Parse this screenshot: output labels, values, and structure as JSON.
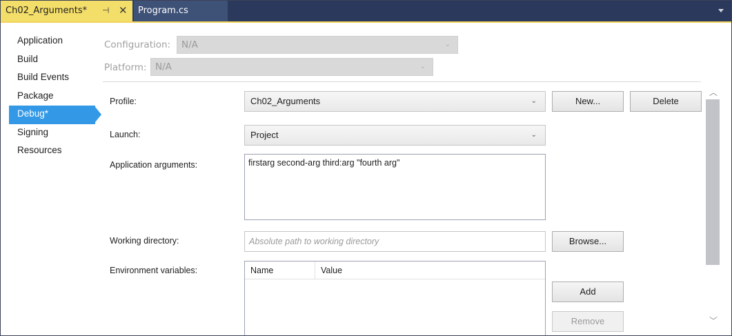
{
  "tabs": {
    "active": {
      "title": "Ch02_Arguments*",
      "pin_glyph": "⊣",
      "close_glyph": "✕"
    },
    "inactive": {
      "title": "Program.cs"
    },
    "overflow_icon": "chevron-down-icon"
  },
  "sidebar": {
    "items": [
      {
        "label": "Application"
      },
      {
        "label": "Build"
      },
      {
        "label": "Build Events"
      },
      {
        "label": "Package"
      },
      {
        "label": "Debug*",
        "selected": true
      },
      {
        "label": "Signing"
      },
      {
        "label": "Resources"
      }
    ]
  },
  "config": {
    "configuration_label": "Configuration:",
    "configuration_value": "N/A",
    "platform_label": "Platform:",
    "platform_value": "N/A"
  },
  "form": {
    "profile_label": "Profile:",
    "profile_value": "Ch02_Arguments",
    "new_button": "New...",
    "delete_button": "Delete",
    "launch_label": "Launch:",
    "launch_value": "Project",
    "args_label": "Application arguments:",
    "args_value": "firstarg second-arg third:arg \"fourth arg\"",
    "workdir_label": "Working directory:",
    "workdir_placeholder": "Absolute path to working directory",
    "browse_button": "Browse...",
    "env_label": "Environment variables:",
    "env_columns": {
      "name": "Name",
      "value": "Value"
    },
    "add_button": "Add",
    "remove_button": "Remove"
  },
  "glyphs": {
    "chevron": "⌄",
    "scroll_up": "︿",
    "scroll_down": "﹀"
  }
}
